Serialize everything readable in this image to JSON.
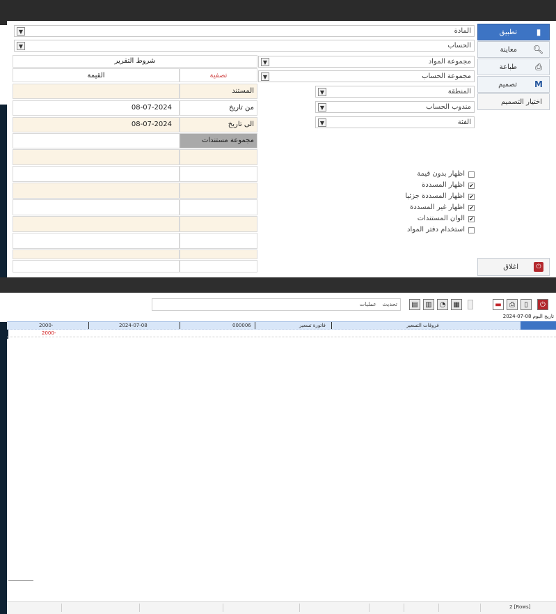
{
  "form": {
    "material_label": "المادة",
    "account_label": "الحساب",
    "report_conditions": "شروط التقرير",
    "material_group_label": "مجموعة المواد",
    "account_group_label": "مجموعة الحساب",
    "region_label": "المنطقة",
    "account_rep_label": "مندوب الحساب",
    "category_label": "الفئة",
    "col_filter": "تصفية",
    "col_value": "القيمة",
    "doc_label": "المستند",
    "from_date_label": "من تاريخ",
    "from_date_value": "08-07-2024",
    "to_date_label": "الى تاريخ",
    "to_date_value": "08-07-2024",
    "doc_groups_label": "مجموعة مستندات"
  },
  "options": [
    {
      "label": "اظهار بدون قيمة",
      "checked": false
    },
    {
      "label": "اظهار المسددة",
      "checked": true
    },
    {
      "label": "اظهار المسددة جزئيا",
      "checked": true
    },
    {
      "label": "اظهار غير المسددة",
      "checked": true
    },
    {
      "label": "الوان المستندات",
      "checked": true
    },
    {
      "label": "استخدام دفتر المواد",
      "checked": false
    }
  ],
  "side": {
    "apply": "تطبيق",
    "preview": "معاينة",
    "print": "طباعة",
    "design": "تصميم",
    "choose_design": "اختيار التصميم",
    "close": "اغلاق"
  },
  "toolbar": {
    "operations": "عمليات",
    "refresh": "تحديث",
    "date_prefix": "تاريخ اليوم",
    "date_value": "08-07-2024"
  },
  "grid": {
    "row": {
      "doc_type": "فروقات التسعير",
      "doc_name": "فاتورة تسعير",
      "doc_no": "000006",
      "date": "2024-07-08",
      "amount": "2000-"
    },
    "total": "2000-"
  },
  "footer": {
    "rows_count": "2 [Rows]"
  },
  "colors": {
    "primary_blue": "#3d74c4",
    "grid_header": "#d8e6f8",
    "beige": "#fbf3e4",
    "red_total": "#d01818"
  }
}
